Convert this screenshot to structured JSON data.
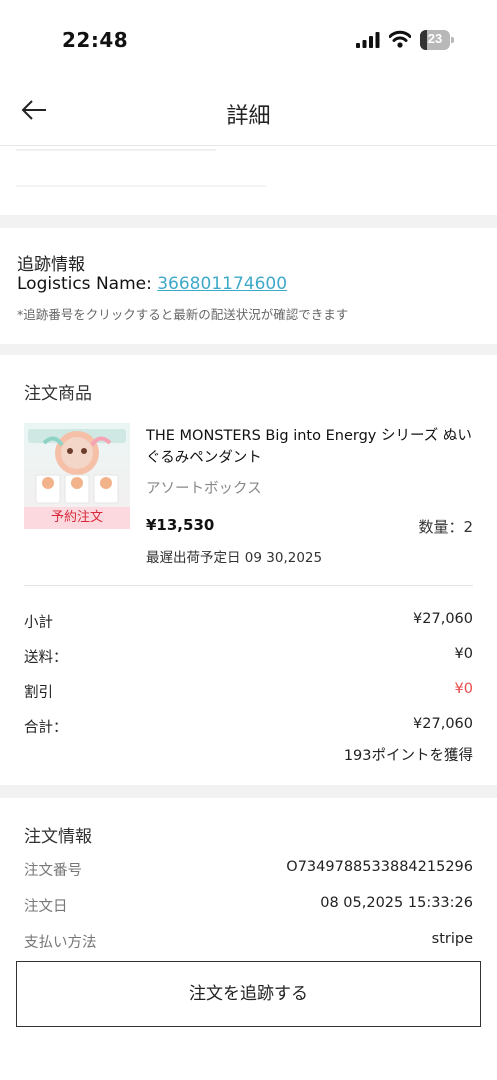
{
  "status_bar": {
    "time": "22:48",
    "battery": "23",
    "battery_level": 0.23
  },
  "nav": {
    "title": "詳細"
  },
  "tracking": {
    "title": "追跡情報",
    "logistics_label": "Logistics Name: ",
    "tracking_number": "366801174600",
    "note": "*追跡番号をクリックすると最新の配送状況が確認できます"
  },
  "order_items": {
    "title": "注文商品",
    "product": {
      "preorder_badge": "予約注文",
      "name": "THE MONSTERS Big into Energy シリーズ ぬいぐるみペンダント",
      "variant": "アソートボックス",
      "price": "¥13,530",
      "quantity": "数量：2",
      "ship_date": "最遅出荷予定日 09 30,2025"
    },
    "summary": {
      "subtotal_label": "小計",
      "subtotal_value": "¥27,060",
      "shipping_label": "送料：",
      "shipping_value": "¥0",
      "discount_label": "割引",
      "discount_value": "¥0",
      "total_label": "合計：",
      "total_value": "¥27,060",
      "points": "193ポイントを獲得"
    }
  },
  "order_info": {
    "title": "注文情報",
    "order_number_label": "注文番号",
    "order_number_value": "O734978853388421529​6",
    "order_date_label": "注文日",
    "order_date_value": "08 05,2025 15:33:26",
    "payment_label": "支払い方法",
    "payment_value": "stripe",
    "track_button": "注文を追跡する"
  },
  "colors": {
    "link": "#3fa9c9",
    "discount": "#e84a4a",
    "badge_bg": "#fbd9de",
    "badge_text": "#d8283b"
  }
}
